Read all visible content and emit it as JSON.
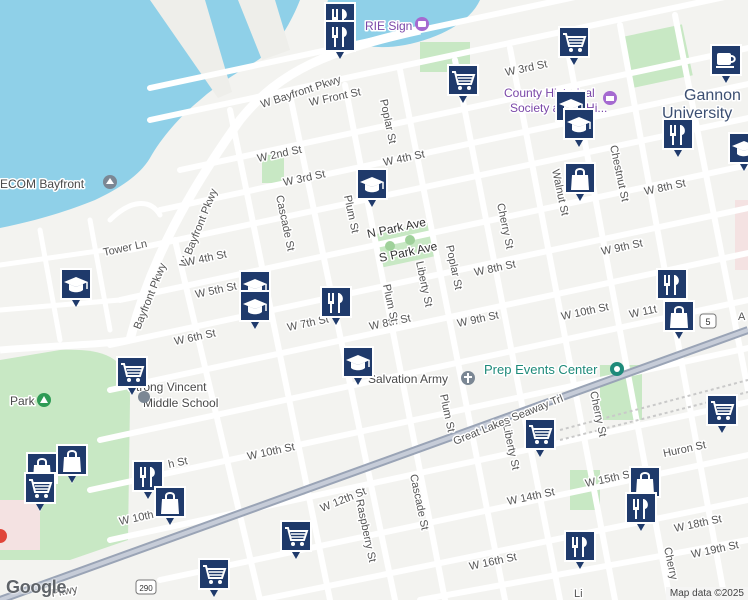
{
  "attribution": {
    "logo": "Google",
    "map_data": "Map data ©2025"
  },
  "places": {
    "bayfront": "ECOM Bayfront",
    "park": "Park",
    "school": "Strong Vincent\nMiddle School",
    "school_line1": "Strong Vincent",
    "school_line2": "Middle School",
    "salvation": "Salvation Army",
    "prep": "Prep Events Center",
    "history": "County Historical",
    "history2": "Society at the Hi...",
    "sign": "RIE Sign",
    "university": "Gannon",
    "university2": "University"
  },
  "streets": {
    "bayfront_pkwy": "W Bayfront Pkwy",
    "bayfront_pkwy2": "Bayfront Pkwy",
    "front": "W Front St",
    "st2": "W 2nd St",
    "st3": "W 3rd St",
    "st3e": "W 3rd St",
    "st4": "W 4th St",
    "st4e": "W 4th St",
    "st5": "W 5th St",
    "st6": "W 6th St",
    "st7": "W 7th St",
    "st8": "W 8th St",
    "st8e": "W 8th St",
    "st8f": "W 8th St",
    "st9": "W 9th St",
    "st9e": "W 9th St",
    "st10": "W 10th St",
    "st10e": "W 10th St",
    "st10w": "W 10th St",
    "st11": "W 11t",
    "st12": "W 12th St",
    "st14": "W 14th St",
    "st15": "W 15th St",
    "st16": "W 16th St",
    "st18": "W 18th St",
    "st19": "W 19th St",
    "huron": "Huron St",
    "tower": "Tower Ln",
    "n_park": "N Park Ave",
    "s_park": "S Park Ave",
    "poplar": "Poplar St",
    "poplar2": "Poplar St",
    "cascade": "Cascade St",
    "cascade2": "Cascade St",
    "plum": "Plum St",
    "plum2": "Plum St",
    "plum3": "Plum St",
    "liberty": "Liberty St",
    "liberty2": "Liberty St",
    "cherry": "Cherry St",
    "cherry2": "Cherry St",
    "cherry3": "Cherry",
    "raspberry": "Raspberry St",
    "walnut": "Walnut St",
    "chestnut": "Chestnut St",
    "seaway": "Great Lakes Seaway Trl",
    "pkwy_w": "Pkwy",
    "a_edge": "A",
    "st13": "h St",
    "st10_s": "W 10th S",
    "st9th": "9th St",
    "l_edge": "Li",
    "route5": "5",
    "route290": "290"
  },
  "markers": [
    {
      "name": "restaurant-marker-1",
      "icon": "restaurant"
    },
    {
      "name": "restaurant-marker-2",
      "icon": "restaurant"
    },
    {
      "name": "shopping-cart-marker-1",
      "icon": "cart"
    },
    {
      "name": "shopping-cart-marker-2",
      "icon": "cart"
    },
    {
      "name": "cafe-marker",
      "icon": "cafe"
    },
    {
      "name": "school-marker-1",
      "icon": "school"
    },
    {
      "name": "school-marker-2",
      "icon": "school"
    },
    {
      "name": "restaurant-marker-3",
      "icon": "restaurant"
    },
    {
      "name": "school-marker-3",
      "icon": "school"
    },
    {
      "name": "shopping-bag-marker-1",
      "icon": "bag"
    },
    {
      "name": "school-marker-4",
      "icon": "school"
    },
    {
      "name": "school-marker-5",
      "icon": "school"
    },
    {
      "name": "school-marker-6",
      "icon": "school"
    },
    {
      "name": "restaurant-marker-4",
      "icon": "restaurant"
    },
    {
      "name": "school-marker-7",
      "icon": "school"
    },
    {
      "name": "restaurant-marker-5",
      "icon": "restaurant"
    },
    {
      "name": "shopping-bag-marker-2",
      "icon": "bag"
    },
    {
      "name": "school-marker-8",
      "icon": "school"
    },
    {
      "name": "shopping-cart-marker-3",
      "icon": "cart"
    },
    {
      "name": "shopping-bag-marker-3",
      "icon": "bag"
    },
    {
      "name": "shopping-bag-marker-4",
      "icon": "bag"
    },
    {
      "name": "shopping-cart-marker-4",
      "icon": "cart"
    },
    {
      "name": "restaurant-marker-6",
      "icon": "restaurant"
    },
    {
      "name": "shopping-bag-marker-5",
      "icon": "bag"
    },
    {
      "name": "shopping-cart-marker-5",
      "icon": "cart"
    },
    {
      "name": "shopping-cart-marker-6",
      "icon": "cart"
    },
    {
      "name": "shopping-cart-marker-7",
      "icon": "cart"
    },
    {
      "name": "shopping-bag-marker-6",
      "icon": "bag"
    },
    {
      "name": "restaurant-marker-7",
      "icon": "restaurant"
    },
    {
      "name": "restaurant-marker-8",
      "icon": "restaurant"
    },
    {
      "name": "shopping-cart-marker-8",
      "icon": "cart"
    }
  ],
  "colors": {
    "marker": "#1f3a6b",
    "water": "#8fd0e8",
    "park": "#c8e8c4",
    "route": "#9aa4b6"
  }
}
